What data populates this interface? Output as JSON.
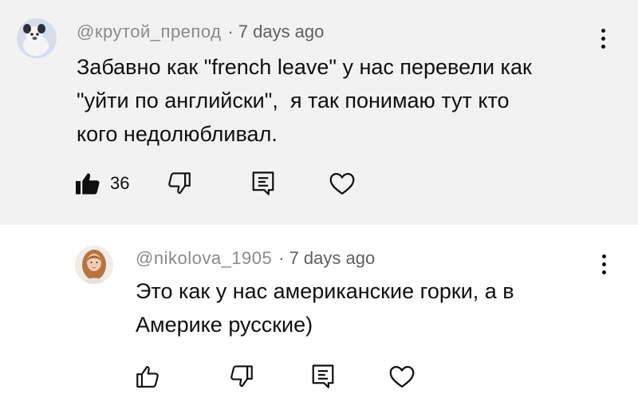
{
  "comments": [
    {
      "handle": "@крутой_препод",
      "time": "7 days ago",
      "lines": [
        "Забавно как \"french leave\" у нас перевели как",
        "\"уйти по английски\",  я так понимаю тут кто",
        "кого недолюбливал."
      ],
      "likes": "36",
      "liked": true,
      "avatar_color": "#dfe4ee"
    },
    {
      "handle": "@nikolova_1905",
      "time": "7 days ago",
      "lines": [
        "Это как у нас американские горки, а в",
        "Америке русские)"
      ],
      "likes": "",
      "liked": false,
      "avatar_color": "#efe6df"
    }
  ],
  "icons": {
    "like": "thumbs-up-icon",
    "dislike": "thumbs-down-icon",
    "reply": "reply-icon",
    "heart": "heart-icon",
    "menu": "more-vertical-icon"
  },
  "colors": {
    "highlight_bg": "#f2f2f2",
    "meta_text": "#606060",
    "text": "#0f0f0f"
  }
}
